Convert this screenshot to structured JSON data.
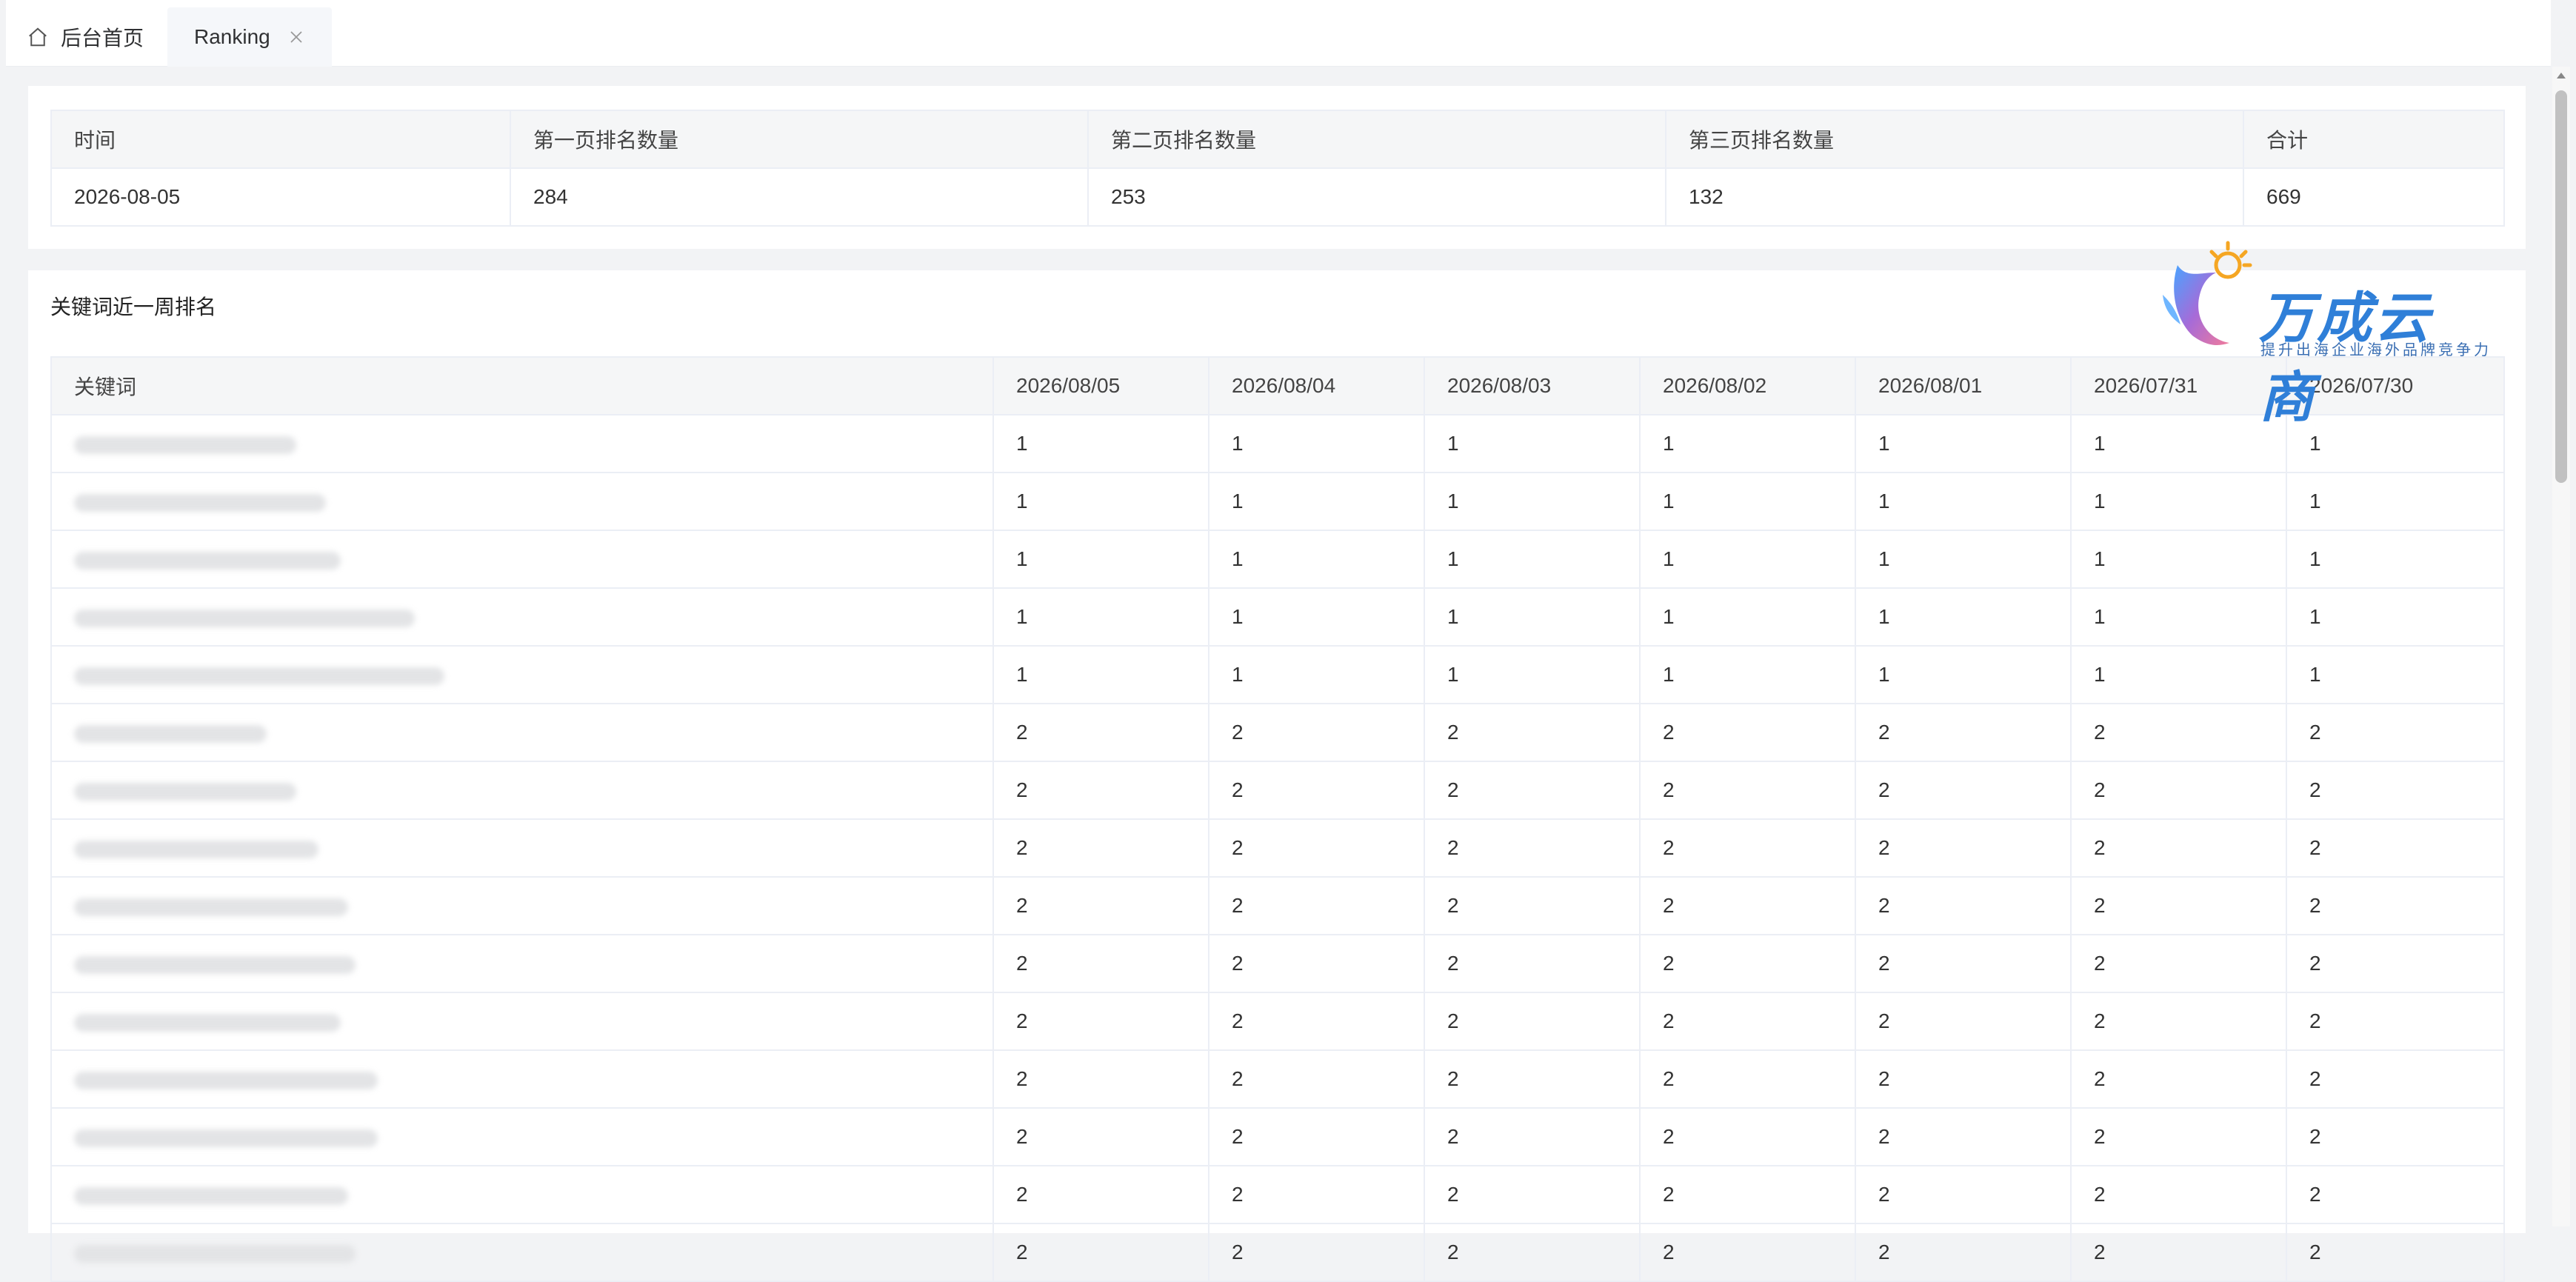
{
  "tabs": {
    "home_label": "后台首页",
    "active_label": "Ranking"
  },
  "summary": {
    "headers": [
      "时间",
      "第一页排名数量",
      "第二页排名数量",
      "第三页排名数量",
      "合计"
    ],
    "row": [
      "2026-08-05",
      "284",
      "253",
      "132",
      "669"
    ]
  },
  "keywords": {
    "title": "关键词近一周排名",
    "headers": [
      "关键词",
      "2026/08/05",
      "2026/08/04",
      "2026/08/03",
      "2026/08/02",
      "2026/08/01",
      "2026/07/31",
      "2026/07/30"
    ],
    "rows": [
      {
        "keyword": "",
        "ranks": [
          "1",
          "1",
          "1",
          "1",
          "1",
          "1",
          "1"
        ]
      },
      {
        "keyword": "",
        "ranks": [
          "1",
          "1",
          "1",
          "1",
          "1",
          "1",
          "1"
        ]
      },
      {
        "keyword": "",
        "ranks": [
          "1",
          "1",
          "1",
          "1",
          "1",
          "1",
          "1"
        ]
      },
      {
        "keyword": "",
        "ranks": [
          "1",
          "1",
          "1",
          "1",
          "1",
          "1",
          "1"
        ]
      },
      {
        "keyword": "",
        "ranks": [
          "1",
          "1",
          "1",
          "1",
          "1",
          "1",
          "1"
        ]
      },
      {
        "keyword": "",
        "ranks": [
          "2",
          "2",
          "2",
          "2",
          "2",
          "2",
          "2"
        ]
      },
      {
        "keyword": "",
        "ranks": [
          "2",
          "2",
          "2",
          "2",
          "2",
          "2",
          "2"
        ]
      },
      {
        "keyword": "",
        "ranks": [
          "2",
          "2",
          "2",
          "2",
          "2",
          "2",
          "2"
        ]
      },
      {
        "keyword": "",
        "ranks": [
          "2",
          "2",
          "2",
          "2",
          "2",
          "2",
          "2"
        ]
      },
      {
        "keyword": "",
        "ranks": [
          "2",
          "2",
          "2",
          "2",
          "2",
          "2",
          "2"
        ]
      },
      {
        "keyword": "",
        "ranks": [
          "2",
          "2",
          "2",
          "2",
          "2",
          "2",
          "2"
        ]
      },
      {
        "keyword": "",
        "ranks": [
          "2",
          "2",
          "2",
          "2",
          "2",
          "2",
          "2"
        ]
      },
      {
        "keyword": "",
        "ranks": [
          "2",
          "2",
          "2",
          "2",
          "2",
          "2",
          "2"
        ]
      },
      {
        "keyword": "",
        "ranks": [
          "2",
          "2",
          "2",
          "2",
          "2",
          "2",
          "2"
        ]
      },
      {
        "keyword": "",
        "ranks": [
          "2",
          "2",
          "2",
          "2",
          "2",
          "2",
          "2"
        ]
      }
    ]
  },
  "logo": {
    "brand": "万成云商",
    "slogan": "提升出海企业海外品牌竞争力"
  },
  "icons": {
    "home": "home-icon",
    "close": "close-icon"
  },
  "colors": {
    "accent": "#2f7fd8",
    "header_bg": "#f5f6f7",
    "border": "#ebeef5"
  }
}
